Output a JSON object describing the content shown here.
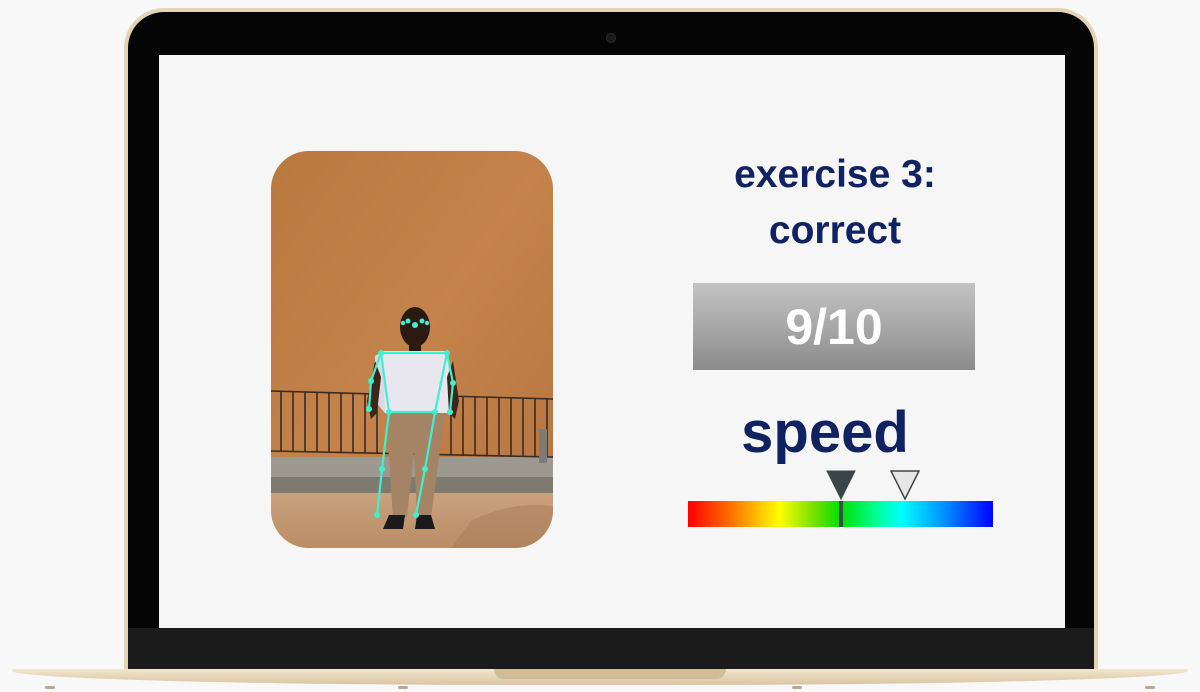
{
  "exercise": {
    "title_line1": "exercise 3:",
    "title_line2": "correct"
  },
  "score": {
    "value": "9/10",
    "numerator": 9,
    "denominator": 10
  },
  "speed": {
    "label": "speed",
    "current_fraction": 0.5,
    "target_fraction": 0.71,
    "gradient_colors": [
      "#ff0000",
      "#ffff00",
      "#00e000",
      "#00ffff",
      "#0000ff"
    ]
  },
  "colors": {
    "text_primary": "#102262",
    "pose_overlay": "#3ef0d0"
  },
  "icons": {
    "current_marker": "filled-triangle-down-icon",
    "target_marker": "outline-triangle-down-icon"
  }
}
